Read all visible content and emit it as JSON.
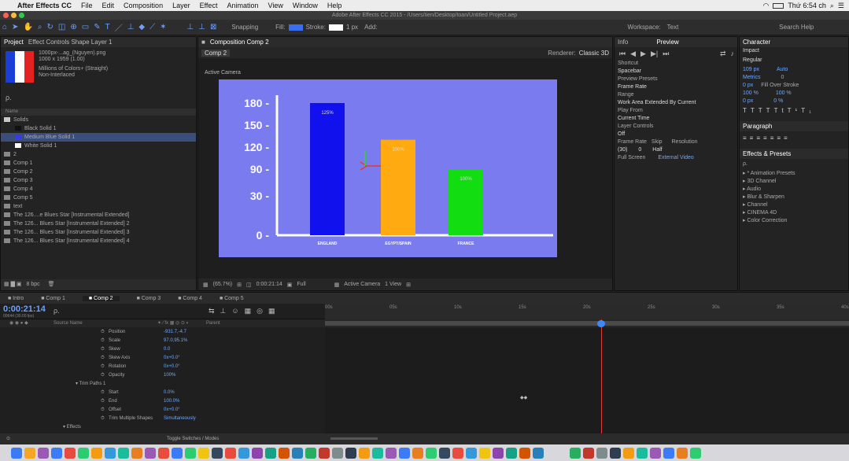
{
  "menubar": {
    "app": "After Effects CC",
    "items": [
      "File",
      "Edit",
      "Composition",
      "Layer",
      "Effect",
      "Animation",
      "View",
      "Window",
      "Help"
    ],
    "clock": "Thứ 6:54 ch"
  },
  "titlebar": {
    "title": "Adobe After Effects CC 2015 - /Users/tien/Desktop/toan/Untitled Project.aep"
  },
  "toolbar": {
    "snapping": "Snapping",
    "fill": "Fill:",
    "stroke": "Stroke:",
    "stroke_px": "1 px",
    "add": "Add:",
    "workspace_label": "Workspace:",
    "workspace": "Text",
    "search": "Search Help"
  },
  "project": {
    "tab": "Project",
    "effect_tab": "Effect Controls Shape Layer 1",
    "file_name": "1000px-...ag_(Nguyen).png",
    "file_info": "1000 x 1959 (1.00)",
    "file_colors": "Millions of Colors+ (Straight)",
    "file_interp": "Non-Interlaced",
    "search_placeholder": "ρ.",
    "col_name": "Name",
    "items": [
      {
        "name": "Solids",
        "color": "#c8c8c8",
        "indent": 0
      },
      {
        "name": "Black Solid 1",
        "color": "#111111",
        "indent": 1
      },
      {
        "name": "Medium Blue Solid 1",
        "color": "#3a3ae0",
        "indent": 1
      },
      {
        "name": "White Solid 1",
        "color": "#ffffff",
        "indent": 1
      },
      {
        "name": "2",
        "color": "#888888",
        "indent": 0
      },
      {
        "name": "Comp 1",
        "color": "#888888",
        "indent": 0
      },
      {
        "name": "Comp 2",
        "color": "#888888",
        "indent": 0
      },
      {
        "name": "Comp 3",
        "color": "#888888",
        "indent": 0
      },
      {
        "name": "Comp 4",
        "color": "#888888",
        "indent": 0
      },
      {
        "name": "Comp 5",
        "color": "#888888",
        "indent": 0
      },
      {
        "name": "text",
        "color": "#888888",
        "indent": 0
      },
      {
        "name": "The 126....e Blues Star [Instrumental Extended]",
        "color": "#888888",
        "indent": 0
      },
      {
        "name": "The 126... Blues Star [Instrumental Extended] 2",
        "color": "#888888",
        "indent": 0
      },
      {
        "name": "The 126... Blues Star [Instrumental Extended] 3",
        "color": "#888888",
        "indent": 0
      },
      {
        "name": "The 126... Blues Star [Instrumental Extended] 4",
        "color": "#888888",
        "indent": 0
      }
    ],
    "bpc": "8 bpc"
  },
  "comp": {
    "tab": "Composition Comp 2",
    "breadcrumb": "Comp 2",
    "renderer_label": "Renderer:",
    "renderer": "Classic 3D",
    "camera": "Active Camera",
    "footer_zoom": "(65.7%)",
    "footer_time": "0:00:21:14",
    "footer_res": "Full",
    "footer_cam": "Active Camera",
    "footer_view": "1 View"
  },
  "chart_data": {
    "type": "bar",
    "categories": [
      "ENGLAND",
      "EGYPT/SPAIN",
      "FRANCE"
    ],
    "values": [
      180,
      130,
      90
    ],
    "data_labels": [
      "125%",
      "100%",
      "100%"
    ],
    "colors": [
      "#1111ee",
      "#ffaa11",
      "#11dd11"
    ],
    "yticks": [
      "180",
      "150",
      "120",
      "90",
      "30",
      "0"
    ],
    "ytick_values": [
      180,
      150,
      120,
      90,
      30,
      0
    ],
    "ylim": [
      0,
      190
    ],
    "bg": "#7b7bf0"
  },
  "preview": {
    "tab": "Preview",
    "shortcut_label": "Shortcut",
    "shortcut": "Spacebar",
    "presets_label": "Preview Presets",
    "preset": "Frame Rate",
    "range_label": "Range",
    "range": "Work Area Extended By Current",
    "play_from_label": "Play From",
    "play_from": "Current Time",
    "layer_controls_label": "Layer Controls",
    "layer_controls": "Off",
    "frame_rate_label": "Frame Rate",
    "skip_label": "Skip",
    "resolution_label": "Resolution",
    "frame_rate": "(30)",
    "skip": "0",
    "resolution": "Half",
    "full_screen": "Full Screen",
    "external": "External Video"
  },
  "character": {
    "tab": "Character",
    "font": "Impact",
    "style": "Regular",
    "size": "109 px",
    "leading": "Auto",
    "tracking": "Metrics",
    "kern": "0",
    "stroke": "0 px",
    "stroke_mode": "Fill Over Stroke",
    "vscale": "100 %",
    "hscale": "100 %",
    "baseline": "0 px",
    "tsume": "0 %"
  },
  "paragraph": {
    "tab": "Paragraph"
  },
  "effects": {
    "tab": "Effects & Presets",
    "search": "ρ.",
    "items": [
      "* Animation Presets",
      "3D Channel",
      "Audio",
      "Blur & Sharpen",
      "Channel",
      "CINEMA 4D",
      "Color Correction"
    ]
  },
  "timeline": {
    "tabs": [
      "Intro",
      "Comp 1",
      "Comp 2",
      "Comp 3",
      "Comp 4",
      "Comp 5"
    ],
    "active_tab": "Comp 2",
    "time": "0:00:21:14",
    "fps": "00644 (30.00 fps)",
    "search": "ρ.",
    "col_source": "Source Name",
    "col_parent": "Parent",
    "props": [
      {
        "name": "Position",
        "value": "-931.7,-4.7"
      },
      {
        "name": "Scale",
        "value": "97.0,95.1%"
      },
      {
        "name": "Skew",
        "value": "0.0"
      },
      {
        "name": "Skew Axis",
        "value": "0x+0.0°"
      },
      {
        "name": "Rotation",
        "value": "0x+0.0°"
      },
      {
        "name": "Opacity",
        "value": "100%"
      }
    ],
    "trim_label": "Trim Paths 1",
    "trim": [
      {
        "name": "Start",
        "value": "0.0%"
      },
      {
        "name": "End",
        "value": "100.0%"
      },
      {
        "name": "Offset",
        "value": "0x+0.0°"
      },
      {
        "name": "Trim Multiple Shapes",
        "value": "Simultaneously"
      }
    ],
    "effects_label": "Effects",
    "toggle": "Toggle Switches / Modes",
    "ruler": [
      "00s",
      "05s",
      "10s",
      "15s",
      "20s",
      "25s",
      "30s",
      "35s",
      "40s"
    ]
  }
}
